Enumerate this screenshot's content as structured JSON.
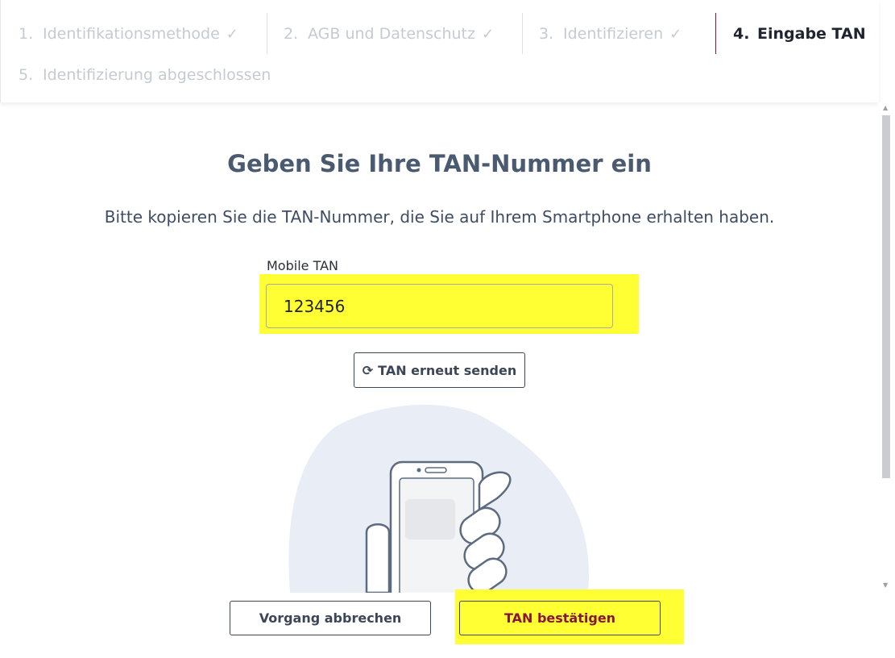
{
  "stepper": {
    "steps": [
      {
        "number": "1.",
        "label": "Identifikationsmethode",
        "check": "✓"
      },
      {
        "number": "2.",
        "label": "AGB und Datenschutz",
        "check": "✓"
      },
      {
        "number": "3.",
        "label": "Identifizieren",
        "check": "✓"
      },
      {
        "number": "4.",
        "label": "Eingabe TAN",
        "check": ""
      },
      {
        "number": "5.",
        "label": "Identifizierung abgeschlossen",
        "check": ""
      }
    ],
    "active_step": 4
  },
  "main": {
    "title": "Geben Sie Ihre TAN-Nummer ein",
    "subtitle": "Bitte kopieren Sie die TAN-Nummer, die Sie auf Ihrem Smartphone erhalten haben.",
    "tan_field": {
      "label": "Mobile TAN",
      "value": "123456"
    },
    "resend_button": {
      "icon": "refresh-icon",
      "label": "TAN erneut senden"
    },
    "illustration": {
      "icon": "hand-holding-smartphone"
    }
  },
  "footer": {
    "cancel_label": "Vorgang abbrechen",
    "confirm_label": "TAN bestätigen"
  },
  "colors": {
    "accent": "#8a1538",
    "highlight": "#ffff33",
    "title_color": "#4a5a70",
    "inactive_step": "#c5cbd3"
  }
}
